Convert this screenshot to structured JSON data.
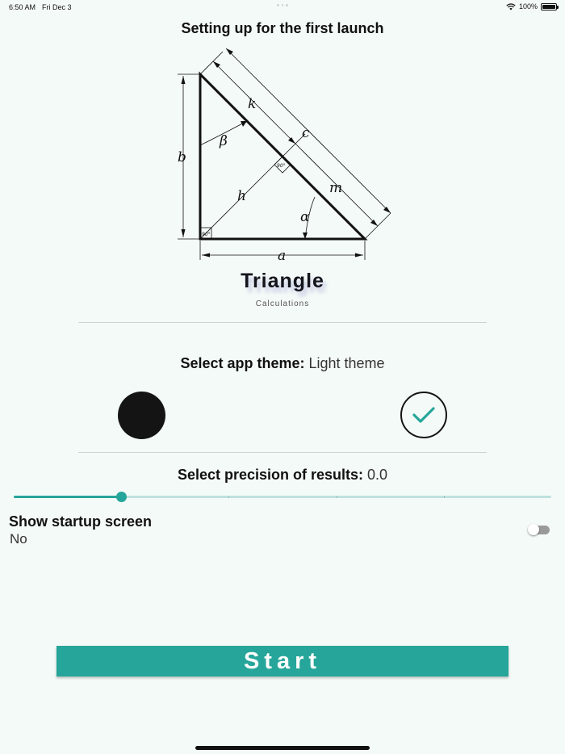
{
  "status_bar": {
    "time": "6:50 AM",
    "date": "Fri Dec 3",
    "battery": "100%"
  },
  "heading": "Setting up for the first launch",
  "diagram": {
    "labels": {
      "a": "a",
      "b": "b",
      "c": "c",
      "k": "k",
      "m": "m",
      "h": "h",
      "alpha": "α",
      "beta": "β"
    },
    "right_angle_label": "90°"
  },
  "app": {
    "name": "Triangle",
    "subtitle": "Calculations"
  },
  "theme": {
    "label": "Select app theme:",
    "value": "Light theme",
    "options": [
      "dark",
      "light"
    ],
    "selected": "light",
    "colors": {
      "dark": "#141414",
      "check": "#26a69a"
    }
  },
  "precision": {
    "label": "Select precision of results:",
    "value": "0.0",
    "slider_fraction": 0.2,
    "stops": 6
  },
  "startup": {
    "title": "Show startup screen",
    "value": "No",
    "enabled": false
  },
  "start_button": {
    "label": "Start"
  },
  "colors": {
    "accent": "#26a69a",
    "background": "#f4faf7"
  }
}
